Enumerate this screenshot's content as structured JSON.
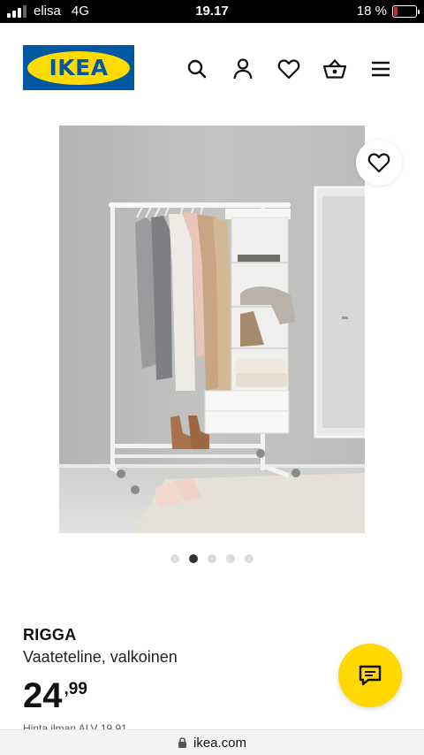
{
  "status_bar": {
    "carrier": "elisa",
    "network": "4G",
    "time": "19.17",
    "battery_text": "18 %",
    "battery_level": 0.18,
    "battery_color": "#e0241b"
  },
  "header": {
    "logo_text": "IKEA",
    "brand_colors": {
      "blue": "#0058a3",
      "yellow": "#ffdb00"
    },
    "icons": [
      "search-icon",
      "user-icon",
      "heart-icon",
      "basket-icon",
      "menu-icon"
    ]
  },
  "gallery": {
    "image_count": 5,
    "active_index": 1,
    "favorite_icon": "heart-outline-icon"
  },
  "product": {
    "name": "RIGGA",
    "description": "Vaateteline, valkoinen",
    "price_integer": "24",
    "price_decimal": ",99",
    "price_note": "Hinta ilman ALV 19,91"
  },
  "chat": {
    "icon": "chat-bubble-icon",
    "color": "#fed800"
  },
  "browser": {
    "url": "ikea.com",
    "lock_icon": "lock-icon"
  }
}
